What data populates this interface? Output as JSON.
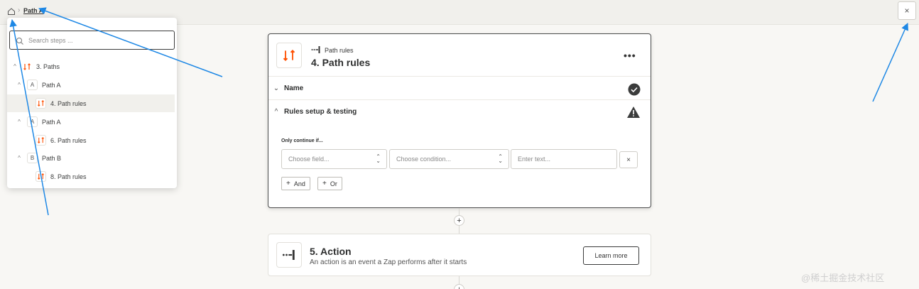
{
  "breadcrumb": {
    "home_icon": "home-icon",
    "current": "Path A"
  },
  "close_label": "×",
  "search": {
    "placeholder": "Search steps ..."
  },
  "tree": [
    {
      "chevron": "^",
      "badge": "paths-icon",
      "label": "3. Paths"
    },
    {
      "chevron": "^",
      "badge": "A",
      "label": "Path A"
    },
    {
      "chevron": "",
      "badge": "paths-icon",
      "label": "4. Path rules",
      "selected": true
    },
    {
      "chevron": "^",
      "badge": "A",
      "label": "Path A"
    },
    {
      "chevron": "",
      "badge": "paths-icon",
      "label": "6. Path rules"
    },
    {
      "chevron": "^",
      "badge": "B",
      "label": "Path B"
    },
    {
      "chevron": "",
      "badge": "paths-icon",
      "label": "8. Path rules"
    }
  ],
  "step_card": {
    "kind": "Path rules",
    "title": "4. Path rules",
    "more": "•••",
    "sections": [
      {
        "chevron": "v",
        "title": "Name",
        "status": "check"
      },
      {
        "chevron": "^",
        "title": "Rules setup & testing",
        "status": "warning"
      }
    ],
    "rules": {
      "label": "Only continue if...",
      "field_placeholder": "Choose field...",
      "condition_placeholder": "Choose condition...",
      "text_placeholder": "Enter text...",
      "remove": "×",
      "and_label": "And",
      "or_label": "Or"
    }
  },
  "action_card": {
    "title": "5. Action",
    "description": "An action is an event a Zap performs after it starts",
    "learn_more": "Learn more"
  },
  "add_step": "+",
  "watermark": "@稀土掘金技术社区",
  "colors": {
    "accent": "#ff4f00",
    "annotation_arrow": "#1e88e5"
  }
}
